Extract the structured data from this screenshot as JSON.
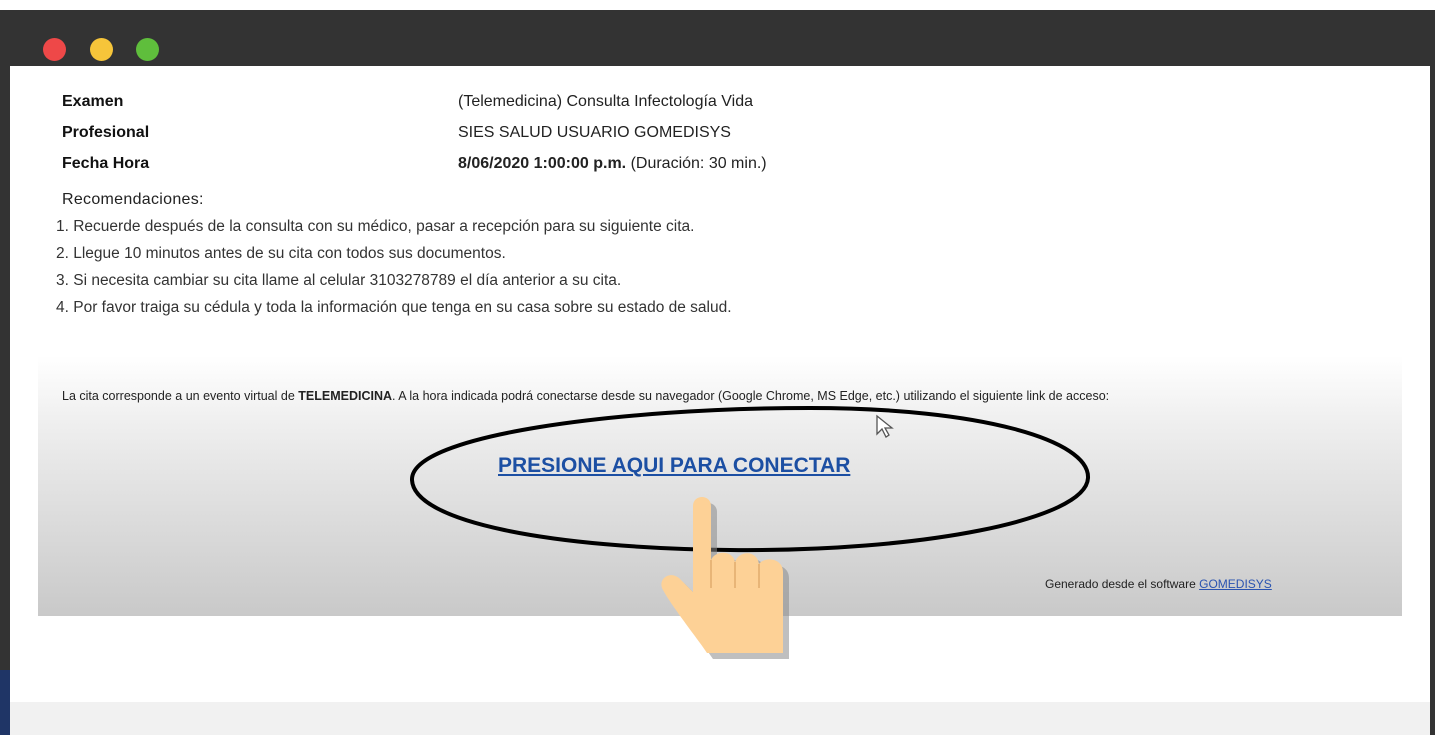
{
  "window": {
    "controls": [
      "close",
      "minimize",
      "maximize"
    ],
    "colors": {
      "titlebar": "#333333",
      "close": "#ee4848",
      "minimize": "#f6c53a",
      "maximize": "#5fbe3c"
    }
  },
  "appointment": {
    "exam_label": "Examen",
    "exam_value": "(Telemedicina) Consulta Infectología Vida",
    "professional_label": "Profesional",
    "professional_value": "SIES SALUD USUARIO GOMEDISYS",
    "datetime_label": "Fecha Hora",
    "datetime_value": "8/06/2020 1:00:00 p.m.",
    "duration": "(Duración: 30 min.)"
  },
  "recommendations": {
    "title": "Recomendaciones:",
    "items": [
      "1. Recuerde después de la consulta con su médico, pasar a recepción para su siguiente cita.",
      "2. Llegue 10 minutos antes de su cita con todos sus documentos.",
      "3. Si necesita cambiar su cita llame al celular 3103278789 el día anterior a su cita.",
      "4. Por favor traiga su cédula y toda la información que tenga en su casa sobre su estado de salud."
    ]
  },
  "telemedicine": {
    "text_before": "La cita corresponde a un evento virtual de",
    "keyword": "TELEMEDICINA",
    "text_after": ". A la hora indicada podrá conectarse desde su navegador (Google Chrome, MS Edge, etc.) utilizando el siguiente link de acceso:",
    "connect_link": "PRESIONE AQUI PARA CONECTAR",
    "link_color": "#1c4fa3"
  },
  "footer": {
    "generated_text": "Generado desde el software",
    "software_link": "GOMEDISYS"
  },
  "icons": [
    "pointing-hand-icon",
    "mouse-cursor-icon"
  ]
}
